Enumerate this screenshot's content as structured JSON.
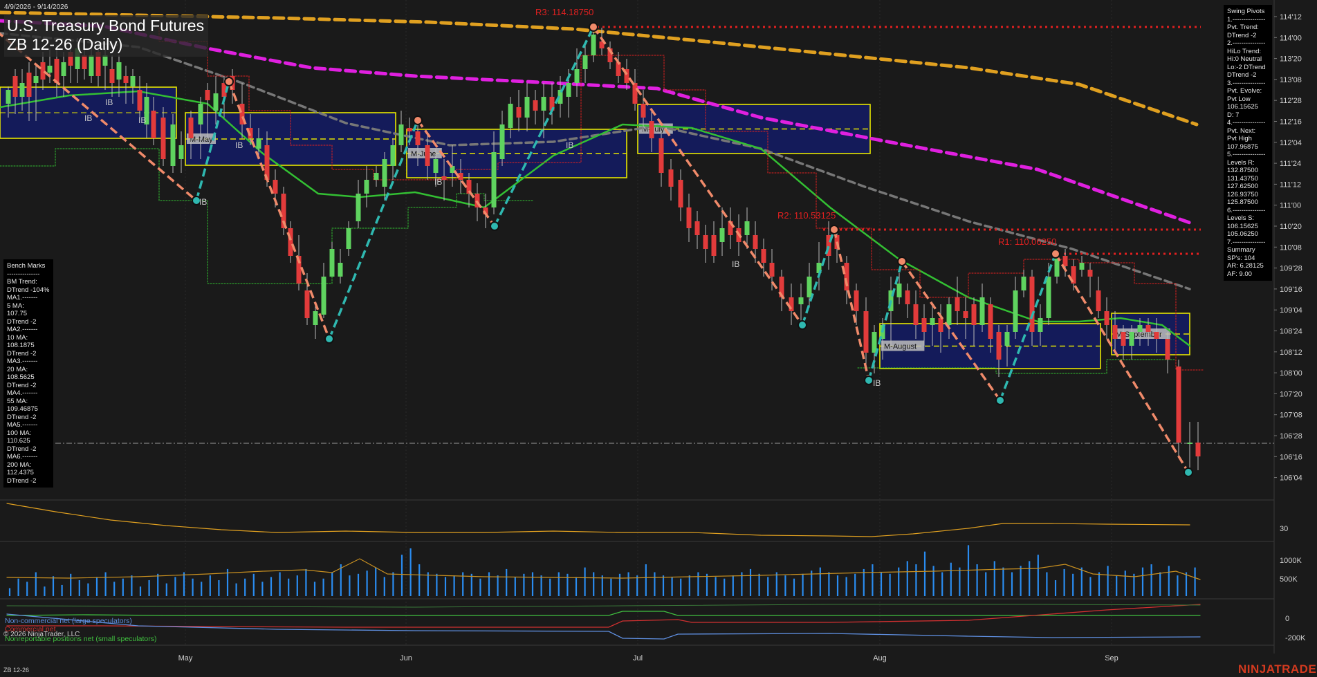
{
  "header": {
    "date_range": "4/9/2026 - 9/14/2026",
    "title_line1": "U.S. Treasury Bond Futures",
    "title_line2": "ZB 12-26 (Daily)"
  },
  "swing_pivots": {
    "lines": [
      "Swing Pivots",
      "1.---------------",
      "Pvt. Trend:",
      "DTrend -2",
      "2.---------------",
      "HiLo Trend:",
      "Hi:0 Neutral",
      "Lo:-2 DTrend",
      "DTrend -2",
      "3.---------------",
      "Pvt. Evolve:",
      "Pvt Low",
      "106.15625",
      "D: 7",
      "4.---------------",
      "Pvt. Next:",
      "Pvt High",
      "107.96875",
      "5.---------------",
      "Levels R:",
      "132.87500",
      "131.43750",
      "127.62500",
      "126.93750",
      "125.87500",
      "6.---------------",
      "Levels S:",
      "106.15625",
      "105.06250",
      "7.---------------",
      "Summary",
      "SP's: 104",
      "AR: 6.28125",
      "AF: 9.00"
    ]
  },
  "benchmarks": {
    "lines": [
      "Bench Marks",
      "---------------",
      "BM Trend:",
      "DTrend -104%",
      "MA1.-------",
      "5 MA:",
      "107.75",
      "DTrend -2",
      "MA2.-------",
      "10 MA:",
      "108.1875",
      "DTrend -2",
      "MA3.-------",
      "20 MA:",
      "108.5625",
      "DTrend -2",
      "MA4.-------",
      "55 MA:",
      "109.46875",
      "DTrend -2",
      "MA5.-------",
      "100 MA:",
      "110.625",
      "DTrend -2",
      "MA6.-------",
      "200 MA:",
      "112.4375",
      "DTrend -2"
    ]
  },
  "cot_legend": {
    "noncommercial": "Non-commercial net (large speculators)",
    "commercial": "Commercial net",
    "nonreportable": "Nonreportable positions net (small speculators)",
    "copyright": "© 2026 NinjaTrader, LLC"
  },
  "footer": {
    "symbol": "ZB 12-26",
    "brand": "NINJATRADER"
  },
  "colors": {
    "background": "#1a1a1a",
    "up_candle": "#5fd35f",
    "down_candle": "#e23b3b",
    "swing_up": "#2fb8b0",
    "swing_down": "#f08a6a",
    "ma_orange": "#e0a020",
    "ma_magenta": "#e020e0",
    "ma_gray": "#777777",
    "ma_green": "#33c033",
    "resistance": "#e02020",
    "box_fill": "#141c66",
    "box_border": "#e6e600",
    "volume": "#2a8cf0",
    "cot_commercial": "#d03030",
    "cot_noncommercial": "#5f8fe0",
    "cot_small": "#40c040"
  },
  "chart_data": [
    {
      "type": "candlestick",
      "title": "U.S. Treasury Bond Futures ZB 12-26 (Daily)",
      "x_labels": [
        "May",
        "Jun",
        "Jul",
        "Aug",
        "Sep"
      ],
      "y_tick_labels": [
        "114'12",
        "114'00",
        "113'20",
        "113'08",
        "112'28",
        "112'16",
        "112'04",
        "111'24",
        "111'12",
        "111'00",
        "110'20",
        "110'08",
        "109'28",
        "109'16",
        "109'04",
        "108'24",
        "108'12",
        "108'00",
        "107'20",
        "107'08",
        "106'28",
        "106'16",
        "106'04"
      ],
      "ylim": [
        105.9,
        114.6
      ],
      "grid": false,
      "pivot_labels": [
        {
          "text": "R3: 114.18750",
          "price": 114.1875
        },
        {
          "text": "R2: 110.53125",
          "price": 110.53125
        },
        {
          "text": "R1: 110.06250",
          "price": 110.0625
        }
      ],
      "monthly_boxes": [
        {
          "label": "M-May",
          "top": 112.3,
          "bottom": 111.35
        },
        {
          "label": "M-June",
          "top": 112.0,
          "bottom": 111.1
        },
        {
          "label": "M-July",
          "top": 112.6,
          "bottom": 111.7
        },
        {
          "label": "M-August",
          "top": 108.75,
          "bottom": 107.9
        },
        {
          "label": "M-September",
          "top": 108.95,
          "bottom": 108.15
        }
      ],
      "ib_labels": [
        "IB",
        "IB",
        "IB",
        "IB",
        "IB",
        "IB",
        "IB",
        "IB",
        "IB"
      ],
      "last_price": 106.15625
    },
    {
      "type": "line",
      "name": "oscillator",
      "y_tick_labels": [
        "30"
      ]
    },
    {
      "type": "bar",
      "name": "volume",
      "y_tick_labels": [
        "1000K",
        "500K"
      ]
    },
    {
      "type": "line",
      "name": "COT",
      "y_tick_labels": [
        "0",
        "-200K"
      ],
      "series": [
        {
          "name": "Non-commercial net (large speculators)"
        },
        {
          "name": "Commercial net"
        },
        {
          "name": "Nonreportable positions net (small speculators)"
        }
      ]
    }
  ]
}
